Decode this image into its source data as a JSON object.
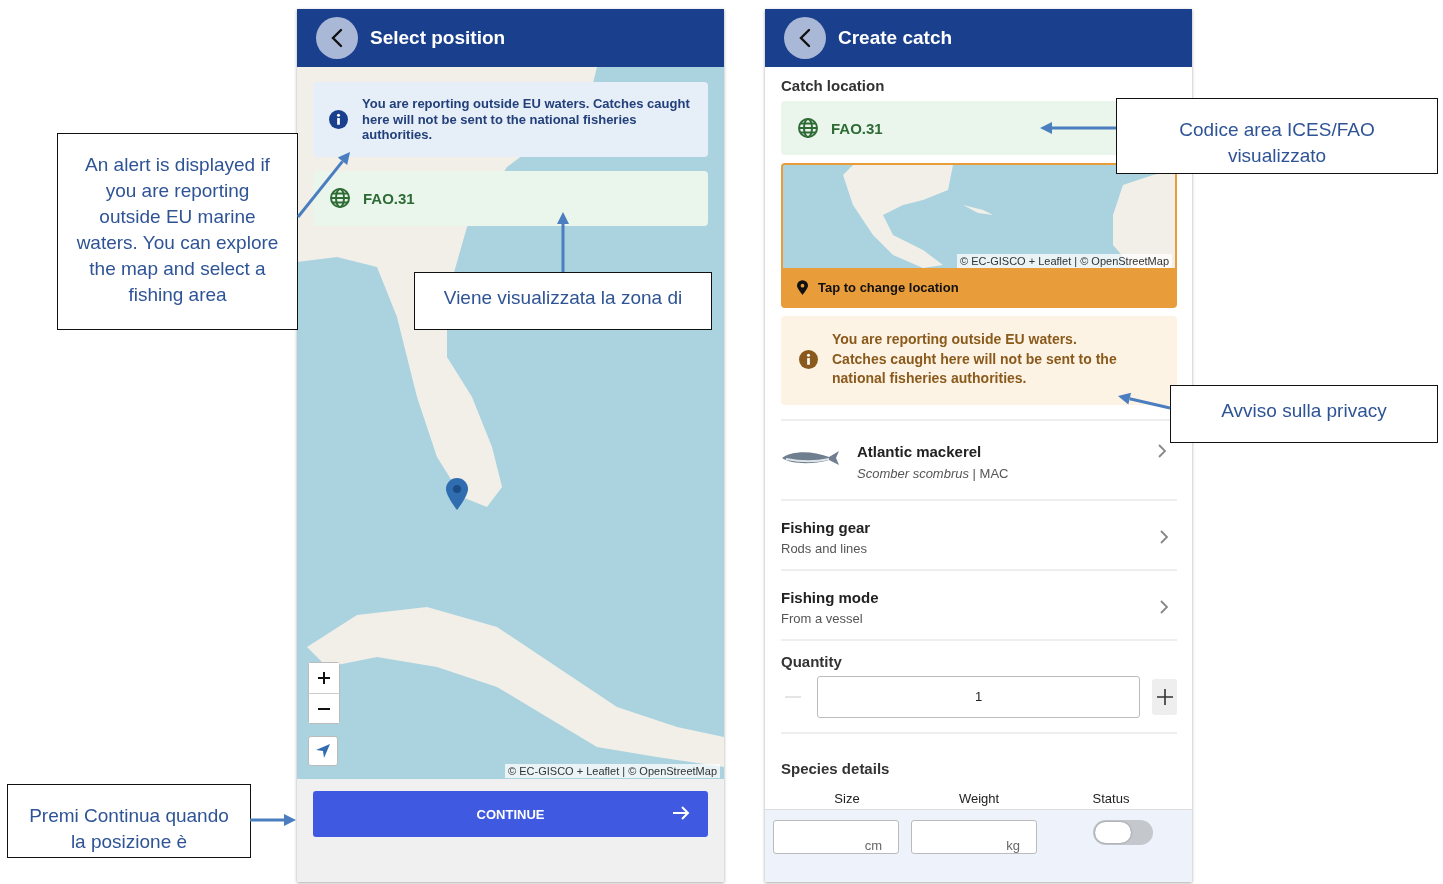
{
  "select_position": {
    "title": "Select position",
    "alert": {
      "text": "You are reporting outside EU waters. Catches caught here will not be sent to the national fisheries authorities."
    },
    "area": {
      "code": "FAO.31"
    },
    "map": {
      "attribution": "© EC-GISCO + Leaflet | © OpenStreetMap"
    },
    "continue_button": {
      "label": "CONTINUE"
    }
  },
  "create_catch": {
    "title": "Create catch",
    "catch_location": {
      "label": "Catch location",
      "area_code": "FAO.31",
      "map_attribution": "© EC-GISCO + Leaflet | © OpenStreetMap",
      "change_label": "Tap to change location"
    },
    "alert": {
      "text": "You are reporting outside EU waters. Catches caught here will not be sent to the national fisheries authorities."
    },
    "species": {
      "name": "Atlantic mackerel",
      "subtitle": "*Scomber scombrus* | MAC"
    },
    "items": [
      {
        "title": "Fishing gear",
        "value": "Rods and lines"
      },
      {
        "title": "Fishing mode",
        "value": "From a vessel"
      }
    ],
    "quantity": {
      "label": "Quantity",
      "value": "1"
    },
    "species_details": {
      "label": "Species details",
      "columns": [
        "Size",
        "Weight",
        "Status"
      ],
      "size_unit": "cm",
      "weight_unit": "kg",
      "status_on": false
    }
  },
  "callouts": [
    {
      "text": "An alert is displayed if you are reporting outside EU marine waters. You can explore the map and select a fishing area"
    },
    {
      "text": "Viene visualizzata la zona di"
    },
    {
      "text": "Codice area ICES/FAO visualizzato"
    },
    {
      "text": "Avviso sulla privacy"
    },
    {
      "text": "Premi Continua quando la posizione è"
    }
  ]
}
